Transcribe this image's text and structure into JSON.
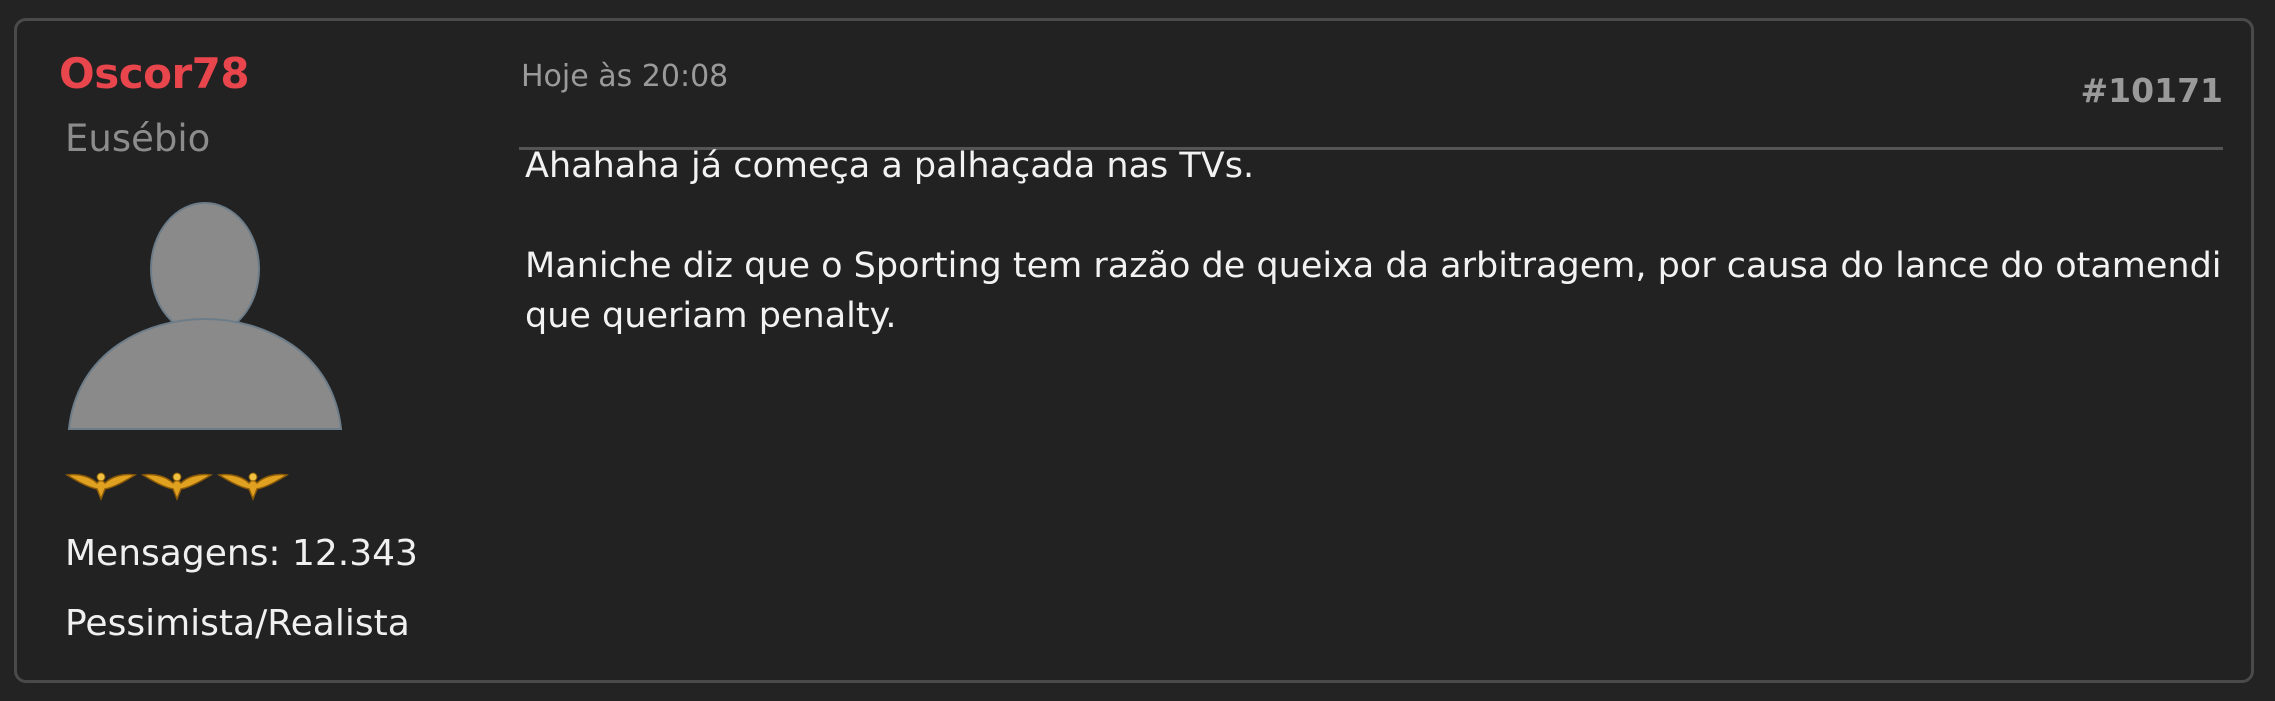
{
  "author": {
    "name": "Oscor78",
    "rank": "Eusébio",
    "avatar_icon": "default-user-icon",
    "medals": [
      "eagle-medal-icon",
      "eagle-medal-icon",
      "eagle-medal-icon"
    ],
    "messages_label": "Mensagens: 12.343",
    "custom_title": "Pessimista/Realista"
  },
  "post": {
    "date": "Hoje às 20:08",
    "number": "#10171",
    "paragraphs": [
      "Ahahaha já começa a palhaçada nas TVs.",
      "Maniche diz que o Sporting tem razão de queixa da arbitragem, por causa do lance do otamendi que queriam penalty."
    ]
  },
  "colors": {
    "background": "#222222",
    "username": "#e8464c",
    "muted": "#8c8c8c",
    "text": "#f2f2f2",
    "medal_gold": "#e0a020"
  }
}
